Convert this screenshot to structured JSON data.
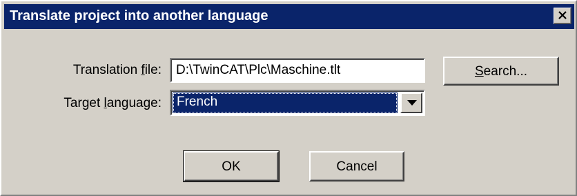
{
  "window": {
    "title": "Translate project into another language",
    "close_icon": "close-icon"
  },
  "form": {
    "translation_file": {
      "label_prefix": "Translation ",
      "label_accel": "f",
      "label_suffix": "ile:",
      "value": "D:\\TwinCAT\\Plc\\Maschine.tlt"
    },
    "target_language": {
      "label_prefix": "Target ",
      "label_accel": "l",
      "label_suffix": "anguage:",
      "selected": "French",
      "dropdown_icon": "chevron-down-icon"
    }
  },
  "buttons": {
    "search": {
      "accel": "S",
      "rest": "earch..."
    },
    "ok": "OK",
    "cancel": "Cancel"
  },
  "colors": {
    "titlebar": "#0a246a",
    "face": "#d4d0c8",
    "selection": "#0a246a"
  }
}
